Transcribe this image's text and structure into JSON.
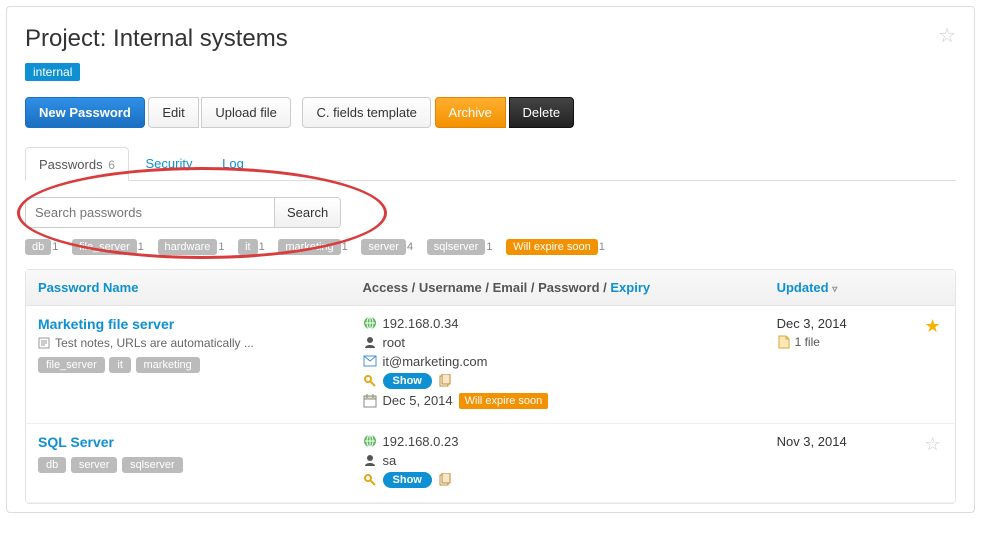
{
  "page_title": "Project: Internal systems",
  "project_tag": "internal",
  "toolbar": {
    "new_password": "New Password",
    "edit": "Edit",
    "upload_file": "Upload file",
    "fields_template": "C. fields template",
    "archive": "Archive",
    "delete": "Delete"
  },
  "tabs": {
    "passwords_label": "Passwords",
    "passwords_count": "6",
    "security_label": "Security",
    "log_label": "Log"
  },
  "search": {
    "placeholder": "Search passwords",
    "button": "Search"
  },
  "filters": [
    {
      "label": "db",
      "count": "1"
    },
    {
      "label": "file_server",
      "count": "1"
    },
    {
      "label": "hardware",
      "count": "1"
    },
    {
      "label": "it",
      "count": "1"
    },
    {
      "label": "marketing",
      "count": "1"
    },
    {
      "label": "server",
      "count": "4"
    },
    {
      "label": "sqlserver",
      "count": "1"
    }
  ],
  "expire_filter": {
    "label": "Will expire soon",
    "count": "1"
  },
  "columns": {
    "name": "Password Name",
    "details_prefix": "Access / Username / Email / Password / ",
    "details_expiry": "Expiry",
    "updated": "Updated"
  },
  "rows": [
    {
      "name": "Marketing file server",
      "note": "Test notes, URLs are automatically ...",
      "tags": [
        "file_server",
        "it",
        "marketing"
      ],
      "access": "192.168.0.34",
      "user": "root",
      "email": "it@marketing.com",
      "show": "Show",
      "expiry_date": "Dec 5, 2014",
      "expiry_badge": "Will expire soon",
      "updated": "Dec 3, 2014",
      "file_count": "1 file",
      "starred": true
    },
    {
      "name": "SQL Server",
      "tags": [
        "db",
        "server",
        "sqlserver"
      ],
      "access": "192.168.0.23",
      "user": "sa",
      "show": "Show",
      "updated": "Nov 3, 2014",
      "starred": false
    }
  ]
}
